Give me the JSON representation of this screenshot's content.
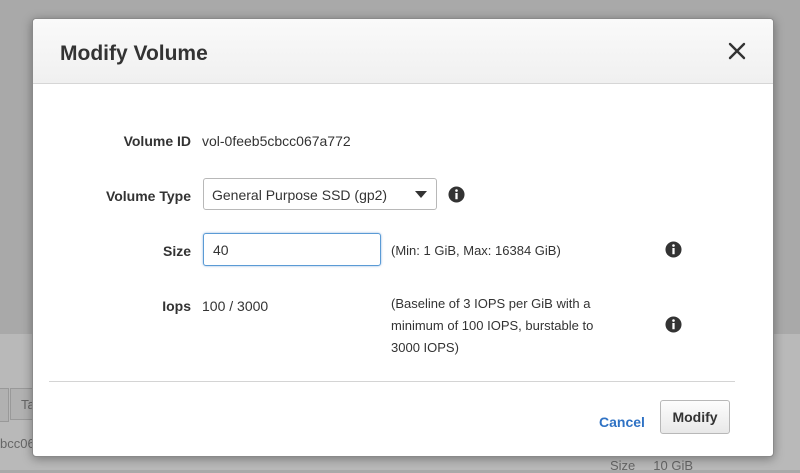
{
  "background": {
    "tab_label": "Ta",
    "left_text": "bcc06",
    "right_label": "Size",
    "right_value": "10 GiB"
  },
  "modal": {
    "title": "Modify Volume",
    "close_icon": "close-icon",
    "fields": {
      "volume_id": {
        "label": "Volume ID",
        "value": "vol-0feeb5cbcc067a772"
      },
      "volume_type": {
        "label": "Volume Type",
        "selected": "General Purpose SSD (gp2)"
      },
      "size": {
        "label": "Size",
        "value": "40",
        "hint": "(Min: 1 GiB, Max: 16384 GiB)"
      },
      "iops": {
        "label": "Iops",
        "value": "100 / 3000",
        "hint_lines": [
          "(Baseline of 3 IOPS per GiB with a",
          "minimum of 100 IOPS, burstable to",
          "3000 IOPS)"
        ]
      }
    },
    "buttons": {
      "cancel": "Cancel",
      "modify": "Modify"
    }
  },
  "colors": {
    "link": "#2f72c4",
    "focus_border": "#5b9bd5",
    "text": "#333333",
    "overlay": "#a9a9a9"
  }
}
